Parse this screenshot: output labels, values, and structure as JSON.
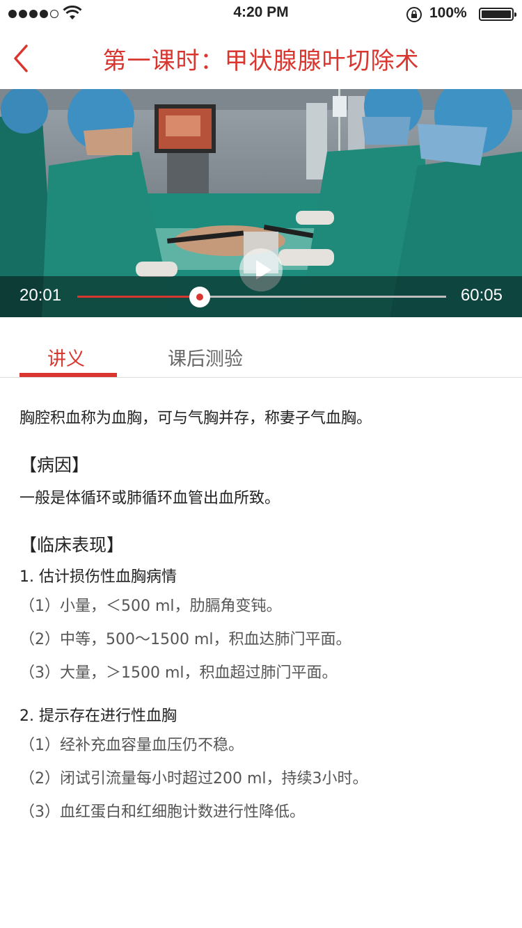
{
  "status_bar": {
    "time": "4:20 PM",
    "battery": "100%"
  },
  "header": {
    "title": "第一课时：甲状腺腺叶切除术"
  },
  "video": {
    "current_time": "20:01",
    "total_time": "60:05",
    "progress": 0.333
  },
  "tabs": [
    {
      "label": "讲义"
    },
    {
      "label": "课后测验"
    }
  ],
  "content": {
    "intro": "胸腔积血称为血胸，可与气胸并存，称妻子气血胸。",
    "cause_title": "【病因】",
    "cause_text": "一般是体循环或肺循环血管出血所致。",
    "clinical_title": "【临床表现】",
    "subsection1_title": "1. 估计损伤性血胸病情",
    "subsection1_items": [
      "（1）小量，＜500 ml，肋膈角变钝。",
      "（2）中等，500～1500 ml，积血达肺门平面。",
      "（3）大量，＞1500 ml，积血超过肺门平面。"
    ],
    "subsection2_title": "2. 提示存在进行性血胸",
    "subsection2_items": [
      "（1）经补充血容量血压仍不稳。",
      "（2）闭试引流量每小时超过200 ml，持续3小时。",
      "（3）血红蛋白和红细胞计数进行性降低。"
    ]
  },
  "colors": {
    "accent": "#d9362f",
    "surgical_gown": "#1f8a7a"
  }
}
